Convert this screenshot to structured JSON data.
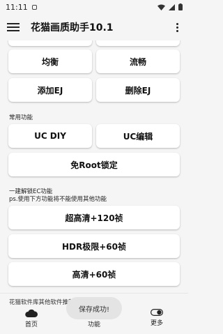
{
  "status_bar": {
    "time": "11:11"
  },
  "app_bar": {
    "title": "花猫画质助手10.1"
  },
  "buttons": {
    "balance": "均衡",
    "smooth": "流畅",
    "add_ej": "添加EJ",
    "delete_ej": "删除EJ",
    "uc_diy": "UC DIY",
    "uc_edit": "UC编辑",
    "root_free_lock": "免Root锁定",
    "ultra_hd_120": "超高清+120祯",
    "hdr_60": "HDR极限+60祯",
    "hd_60": "高清+60祯"
  },
  "labels": {
    "common_functions": "常用功能",
    "unlock_ec": "一建解锁EC功能",
    "unlock_note": "ps.使用下方功能将不能使用其他功能",
    "software_library": "花猫软件库其他软件推荐"
  },
  "toast": {
    "text": "保存成功!"
  },
  "bottom_nav": {
    "home": "首页",
    "functions": "功能",
    "more": "更多"
  }
}
